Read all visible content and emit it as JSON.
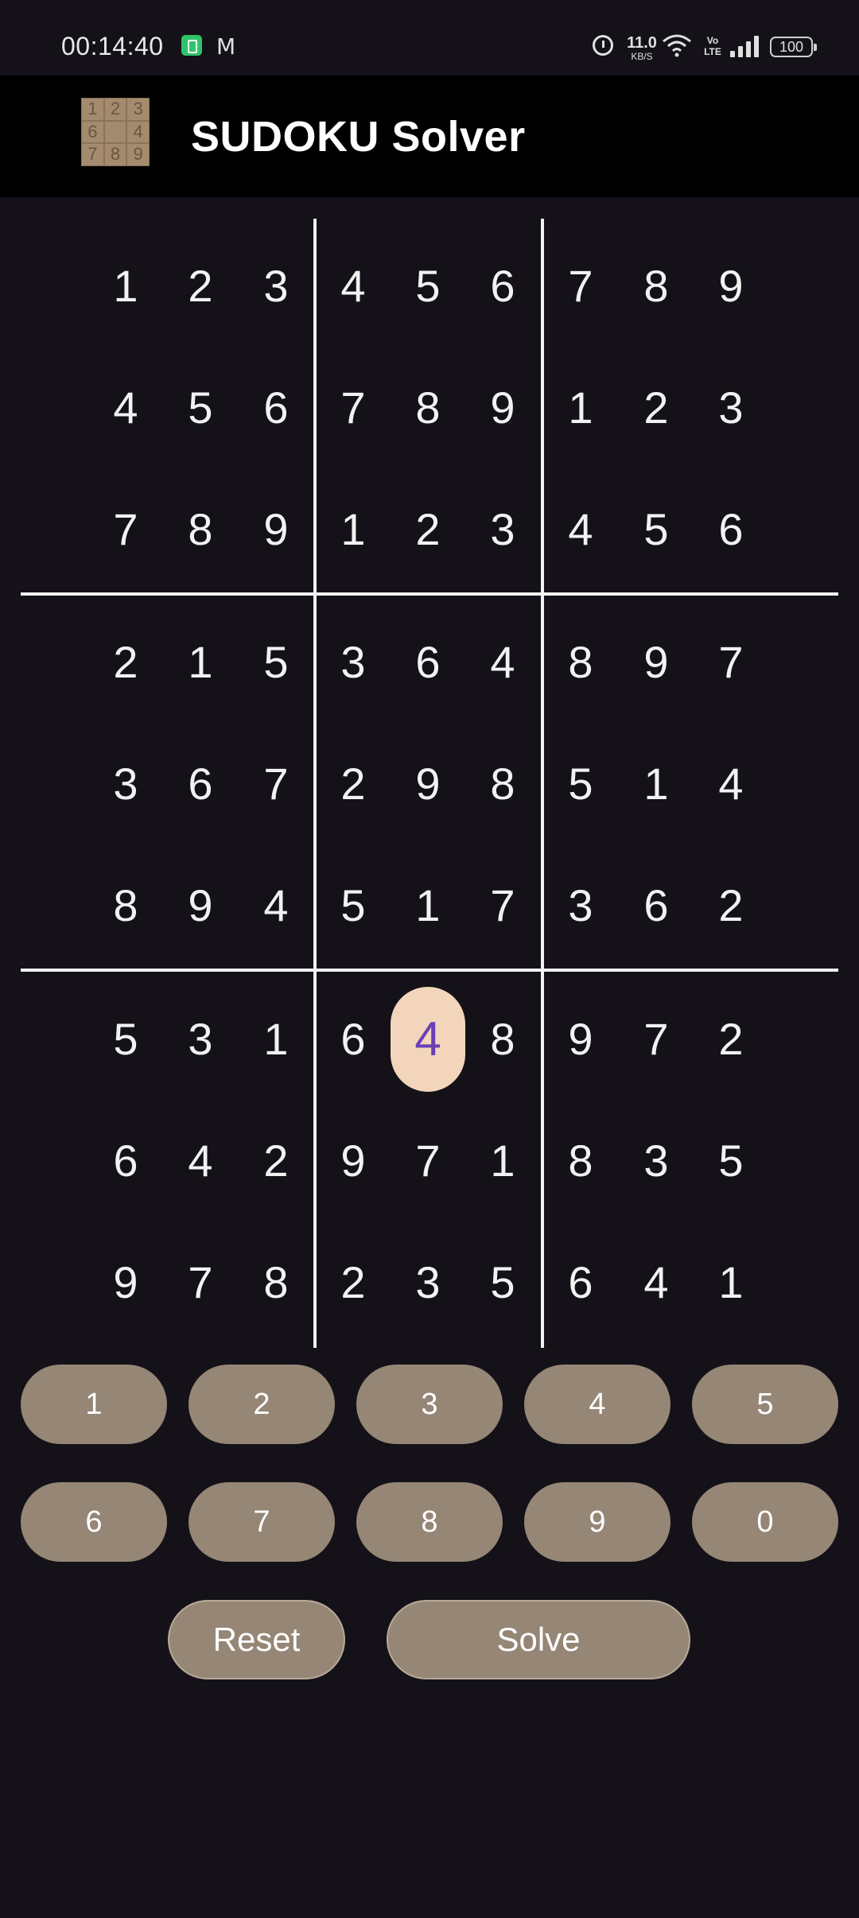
{
  "status_bar": {
    "time": "00:14:40",
    "speed_value": "11.0",
    "speed_unit": "KB/S",
    "network_label": "Vo LTE",
    "battery": "100",
    "icons": [
      "battery-saver-icon",
      "gmail-icon",
      "alarm-icon",
      "wifi-icon",
      "signal-icon",
      "battery-icon"
    ]
  },
  "app_bar": {
    "title": "SUDOKU Solver",
    "logo_digits": [
      "1",
      "2",
      "3",
      "6",
      "",
      "4",
      "7",
      "8",
      "9"
    ]
  },
  "grid": {
    "rows": [
      [
        "1",
        "2",
        "3",
        "4",
        "5",
        "6",
        "7",
        "8",
        "9"
      ],
      [
        "4",
        "5",
        "6",
        "7",
        "8",
        "9",
        "1",
        "2",
        "3"
      ],
      [
        "7",
        "8",
        "9",
        "1",
        "2",
        "3",
        "4",
        "5",
        "6"
      ],
      [
        "2",
        "1",
        "5",
        "3",
        "6",
        "4",
        "8",
        "9",
        "7"
      ],
      [
        "3",
        "6",
        "7",
        "2",
        "9",
        "8",
        "5",
        "1",
        "4"
      ],
      [
        "8",
        "9",
        "4",
        "5",
        "1",
        "7",
        "3",
        "6",
        "2"
      ],
      [
        "5",
        "3",
        "1",
        "6",
        "4",
        "8",
        "9",
        "7",
        "2"
      ],
      [
        "6",
        "4",
        "2",
        "9",
        "7",
        "1",
        "8",
        "3",
        "5"
      ],
      [
        "9",
        "7",
        "8",
        "2",
        "3",
        "5",
        "6",
        "4",
        "1"
      ]
    ],
    "selected_cell": {
      "row": 6,
      "col": 4
    },
    "selected_color": "#f2d5bb",
    "selected_text_color": "#6a3fb5"
  },
  "keypad": {
    "row1": [
      "1",
      "2",
      "3",
      "4",
      "5"
    ],
    "row2": [
      "6",
      "7",
      "8",
      "9",
      "0"
    ]
  },
  "actions": {
    "reset_label": "Reset",
    "solve_label": "Solve"
  },
  "colors": {
    "background": "#141218",
    "app_bar": "#000000",
    "button": "#958676"
  }
}
